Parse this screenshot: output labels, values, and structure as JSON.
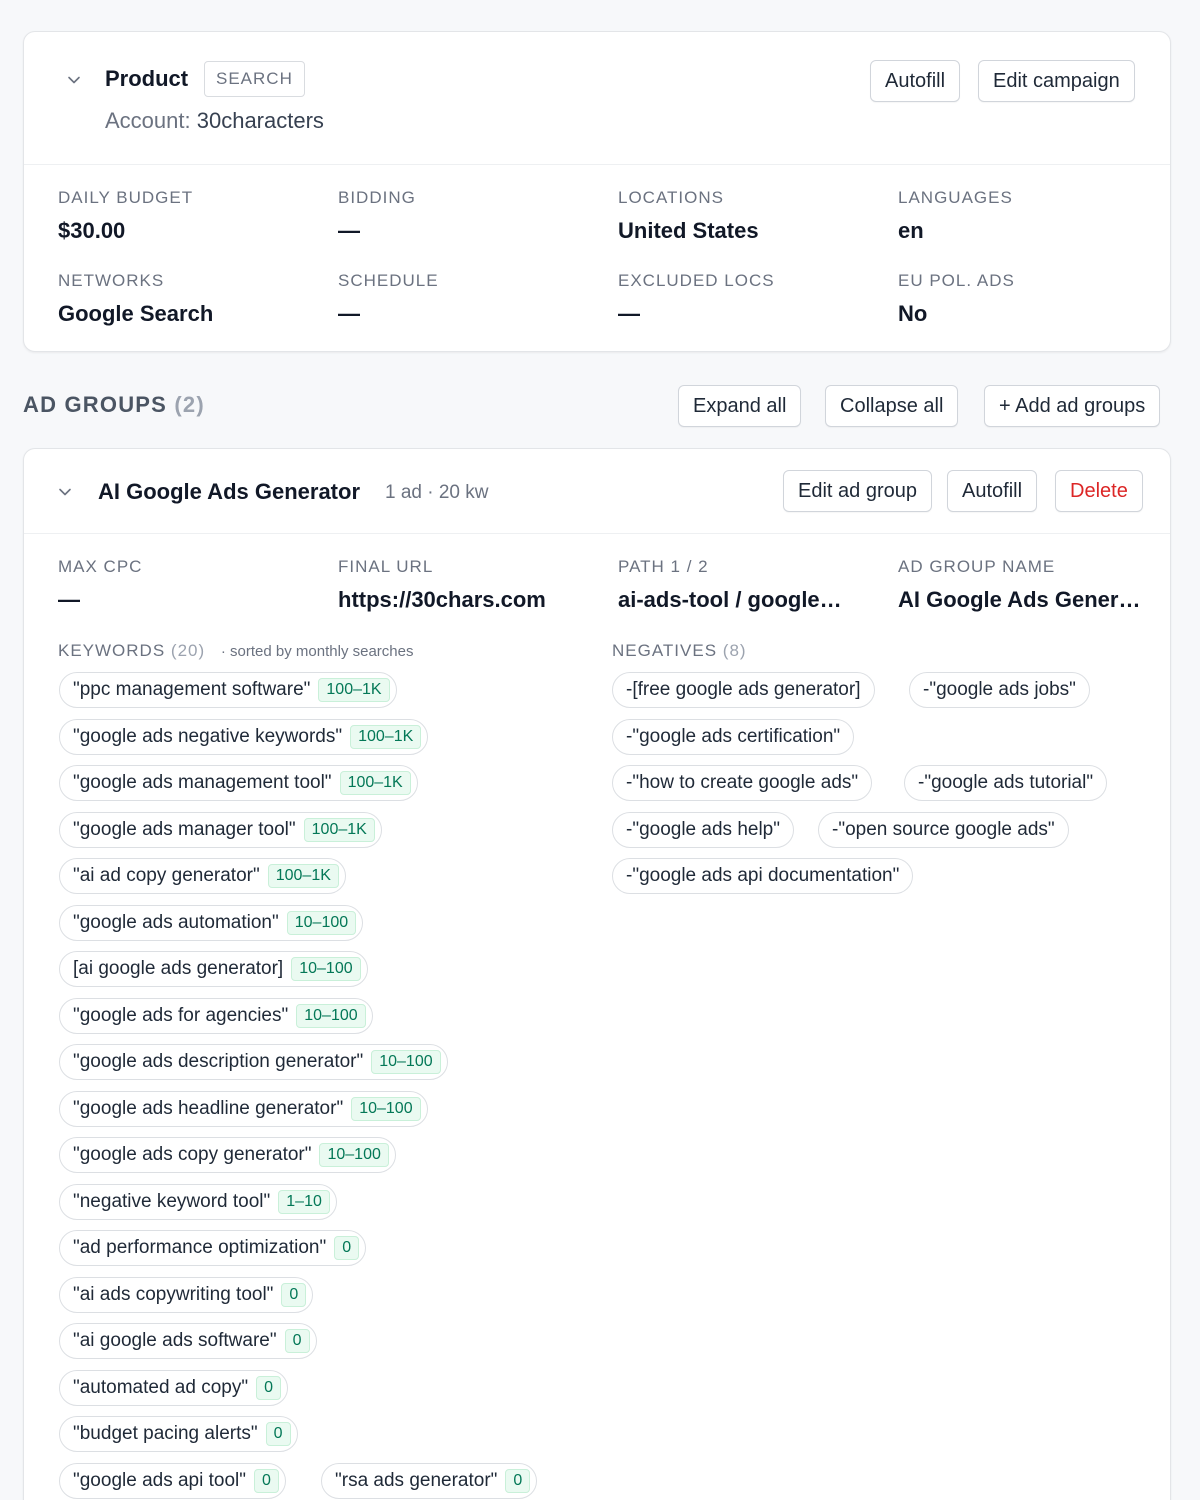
{
  "campaign": {
    "name": "Product",
    "type_badge": "SEARCH",
    "account_label": "Account:",
    "account_value": "30characters",
    "buttons": {
      "autofill": "Autofill",
      "edit": "Edit campaign"
    },
    "stats": [
      {
        "label": "DAILY BUDGET",
        "value": "$30.00"
      },
      {
        "label": "BIDDING",
        "value": "—"
      },
      {
        "label": "LOCATIONS",
        "value": "United States"
      },
      {
        "label": "LANGUAGES",
        "value": "en"
      },
      {
        "label": "NETWORKS",
        "value": "Google Search"
      },
      {
        "label": "SCHEDULE",
        "value": "—"
      },
      {
        "label": "EXCLUDED LOCS",
        "value": "—"
      },
      {
        "label": "EU POL. ADS",
        "value": "No"
      }
    ]
  },
  "ad_groups": {
    "title": "AD GROUPS",
    "count": "(2)",
    "buttons": {
      "expand": "Expand all",
      "collapse": "Collapse all",
      "add": "+ Add ad groups"
    },
    "groups": [
      {
        "name": "AI Google Ads Generator",
        "meta": "1 ad · 20 kw",
        "buttons": {
          "edit": "Edit ad group",
          "autofill": "Autofill",
          "delete": "Delete"
        },
        "stats": [
          {
            "label": "MAX CPC",
            "value": "—"
          },
          {
            "label": "FINAL URL",
            "value": "https://30chars.com"
          },
          {
            "label": "PATH 1 / 2",
            "value": "ai-ads-tool / google…"
          },
          {
            "label": "AD GROUP NAME",
            "value": "AI Google Ads Gener…"
          }
        ],
        "keywords_label": "KEYWORDS",
        "keywords_count": "(20)",
        "keywords_note": "· sorted by monthly searches",
        "keywords": [
          {
            "text": "\"ppc management software\"",
            "volume": "100–1K"
          },
          {
            "text": "\"google ads negative keywords\"",
            "volume": "100–1K"
          },
          {
            "text": "\"google ads management tool\"",
            "volume": "100–1K"
          },
          {
            "text": "\"google ads manager tool\"",
            "volume": "100–1K"
          },
          {
            "text": "\"ai ad copy generator\"",
            "volume": "100–1K"
          },
          {
            "text": "\"google ads automation\"",
            "volume": "10–100"
          },
          {
            "text": "[ai google ads generator]",
            "volume": "10–100"
          },
          {
            "text": "\"google ads for agencies\"",
            "volume": "10–100"
          },
          {
            "text": "\"google ads description generator\"",
            "volume": "10–100"
          },
          {
            "text": "\"google ads headline generator\"",
            "volume": "10–100"
          },
          {
            "text": "\"google ads copy generator\"",
            "volume": "10–100"
          },
          {
            "text": "\"negative keyword tool\"",
            "volume": "1–10"
          },
          {
            "text": "\"ad performance optimization\"",
            "volume": "0"
          },
          {
            "text": "\"ai ads copywriting tool\"",
            "volume": "0"
          },
          {
            "text": "\"ai google ads software\"",
            "volume": "0"
          },
          {
            "text": "\"automated ad copy\"",
            "volume": "0"
          },
          {
            "text": "\"budget pacing alerts\"",
            "volume": "0"
          },
          {
            "text": "\"google ads api tool\"",
            "volume": "0"
          },
          {
            "text": "\"rsa ads generator\"",
            "volume": "0"
          }
        ],
        "negatives_label": "NEGATIVES",
        "negatives_count": "(8)",
        "negatives": [
          "-[free google ads generator]",
          "-\"google ads jobs\"",
          "-\"google ads certification\"",
          "-\"how to create google ads\"",
          "-\"google ads tutorial\"",
          "-\"google ads help\"",
          "-\"open source google ads\"",
          "-\"google ads api documentation\""
        ]
      }
    ]
  },
  "colors": {
    "page_bg": "#f7f8fa",
    "card_bg": "#ffffff",
    "volume_badge_bg": "#eafaf1",
    "volume_badge_text": "#047857",
    "danger": "#dc2626"
  }
}
